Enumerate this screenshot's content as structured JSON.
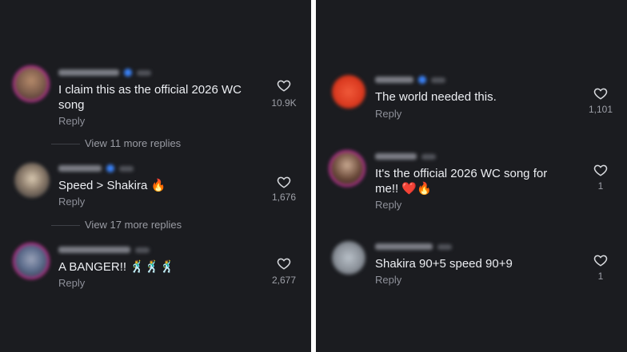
{
  "left_panel": {
    "comments": [
      {
        "text_line1": "I claim this as the official 2026 WC",
        "text_line2": "song",
        "reply": "Reply",
        "likes": "10.9K",
        "view_more": "View 11 more replies",
        "avatar_color": "#7a5a4a"
      },
      {
        "text_line1": "Speed > Shakira 🔥",
        "reply": "Reply",
        "likes": "1,676",
        "view_more": "View 17 more replies",
        "avatar_color": "#8a7a6a"
      },
      {
        "text_line1": "A BANGER!! 🕺🕺🕺",
        "reply": "Reply",
        "likes": "2,677",
        "avatar_color": "#5a6a8a"
      }
    ]
  },
  "right_panel": {
    "comments": [
      {
        "text_line1": "The world needed this.",
        "reply": "Reply",
        "likes": "1,101",
        "avatar_color": "#d9381e"
      },
      {
        "text_line1": "It's the official 2026 WC song for",
        "text_line2": "me!! ❤️🔥",
        "reply": "Reply",
        "likes": "1",
        "avatar_color": "#6b4a3a"
      },
      {
        "text_line1": "Shakira 90+5 speed 90+9",
        "reply": "Reply",
        "likes": "1",
        "avatar_color": "#8a9098"
      }
    ]
  },
  "colors": {
    "background": "#1b1c20",
    "divider": "#ffffff",
    "text": "#eceef2",
    "secondary_text": "#8e9099",
    "verified": "#3b82f6",
    "story_ring": "#b1328a"
  },
  "icons": {
    "like": "heart-outline-icon",
    "verified": "verified-badge-icon"
  }
}
